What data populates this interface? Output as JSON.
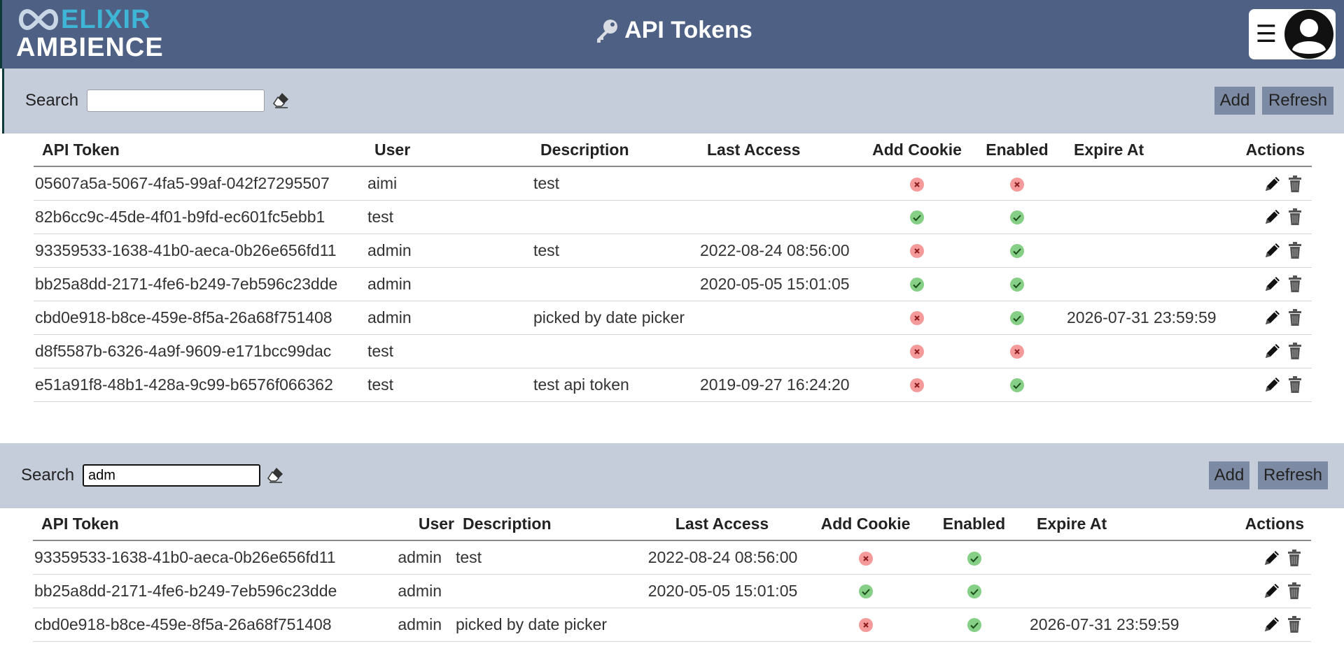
{
  "header": {
    "logo_top": "ELIXIR",
    "logo_bottom": "AMBIENCE",
    "title": "API Tokens",
    "menu_glyph": "☰",
    "icons": {
      "title": "key-icon",
      "menu": "hamburger-icon",
      "user": "user-avatar-icon"
    }
  },
  "colors": {
    "header_bg": "#4e6185",
    "toolbar_bg": "#c5ccda",
    "button_bg": "#7d8aa3",
    "logo_accent": "#3fb5d6",
    "status_yes": "#86cf86",
    "status_no": "#f49a9a"
  },
  "panel1": {
    "search_label": "Search",
    "search_value": "",
    "add_label": "Add",
    "refresh_label": "Refresh",
    "columns": [
      "API Token",
      "User",
      "Description",
      "Last Access",
      "Add Cookie",
      "Enabled",
      "Expire At",
      "Actions"
    ],
    "rows": [
      {
        "token": "05607a5a-5067-4fa5-99af-042f27295507",
        "user": "aimi",
        "description": "test",
        "last_access": "",
        "add_cookie": false,
        "enabled": false,
        "expire_at": ""
      },
      {
        "token": "82b6cc9c-45de-4f01-b9fd-ec601fc5ebb1",
        "user": "test",
        "description": "",
        "last_access": "",
        "add_cookie": true,
        "enabled": true,
        "expire_at": ""
      },
      {
        "token": "93359533-1638-41b0-aeca-0b26e656fd11",
        "user": "admin",
        "description": "test",
        "last_access": "2022-08-24 08:56:00",
        "add_cookie": false,
        "enabled": true,
        "expire_at": ""
      },
      {
        "token": "bb25a8dd-2171-4fe6-b249-7eb596c23dde",
        "user": "admin",
        "description": "",
        "last_access": "2020-05-05 15:01:05",
        "add_cookie": true,
        "enabled": true,
        "expire_at": ""
      },
      {
        "token": "cbd0e918-b8ce-459e-8f5a-26a68f751408",
        "user": "admin",
        "description": "picked by date picker",
        "last_access": "",
        "add_cookie": false,
        "enabled": true,
        "expire_at": "2026-07-31 23:59:59"
      },
      {
        "token": "d8f5587b-6326-4a9f-9609-e171bcc99dac",
        "user": "test",
        "description": "",
        "last_access": "",
        "add_cookie": false,
        "enabled": false,
        "expire_at": ""
      },
      {
        "token": "e51a91f8-48b1-428a-9c99-b6576f066362",
        "user": "test",
        "description": "test api token",
        "last_access": "2019-09-27 16:24:20",
        "add_cookie": false,
        "enabled": true,
        "expire_at": ""
      }
    ]
  },
  "panel2": {
    "search_label": "Search",
    "search_value": "adm",
    "add_label": "Add",
    "refresh_label": "Refresh",
    "columns": [
      "API Token",
      "User",
      "Description",
      "Last Access",
      "Add Cookie",
      "Enabled",
      "Expire At",
      "Actions"
    ],
    "rows": [
      {
        "token": "93359533-1638-41b0-aeca-0b26e656fd11",
        "user": "admin",
        "description": "test",
        "last_access": "2022-08-24 08:56:00",
        "add_cookie": false,
        "enabled": true,
        "expire_at": ""
      },
      {
        "token": "bb25a8dd-2171-4fe6-b249-7eb596c23dde",
        "user": "admin",
        "description": "",
        "last_access": "2020-05-05 15:01:05",
        "add_cookie": true,
        "enabled": true,
        "expire_at": ""
      },
      {
        "token": "cbd0e918-b8ce-459e-8f5a-26a68f751408",
        "user": "admin",
        "description": "picked by date picker",
        "last_access": "",
        "add_cookie": false,
        "enabled": true,
        "expire_at": "2026-07-31 23:59:59"
      }
    ]
  }
}
